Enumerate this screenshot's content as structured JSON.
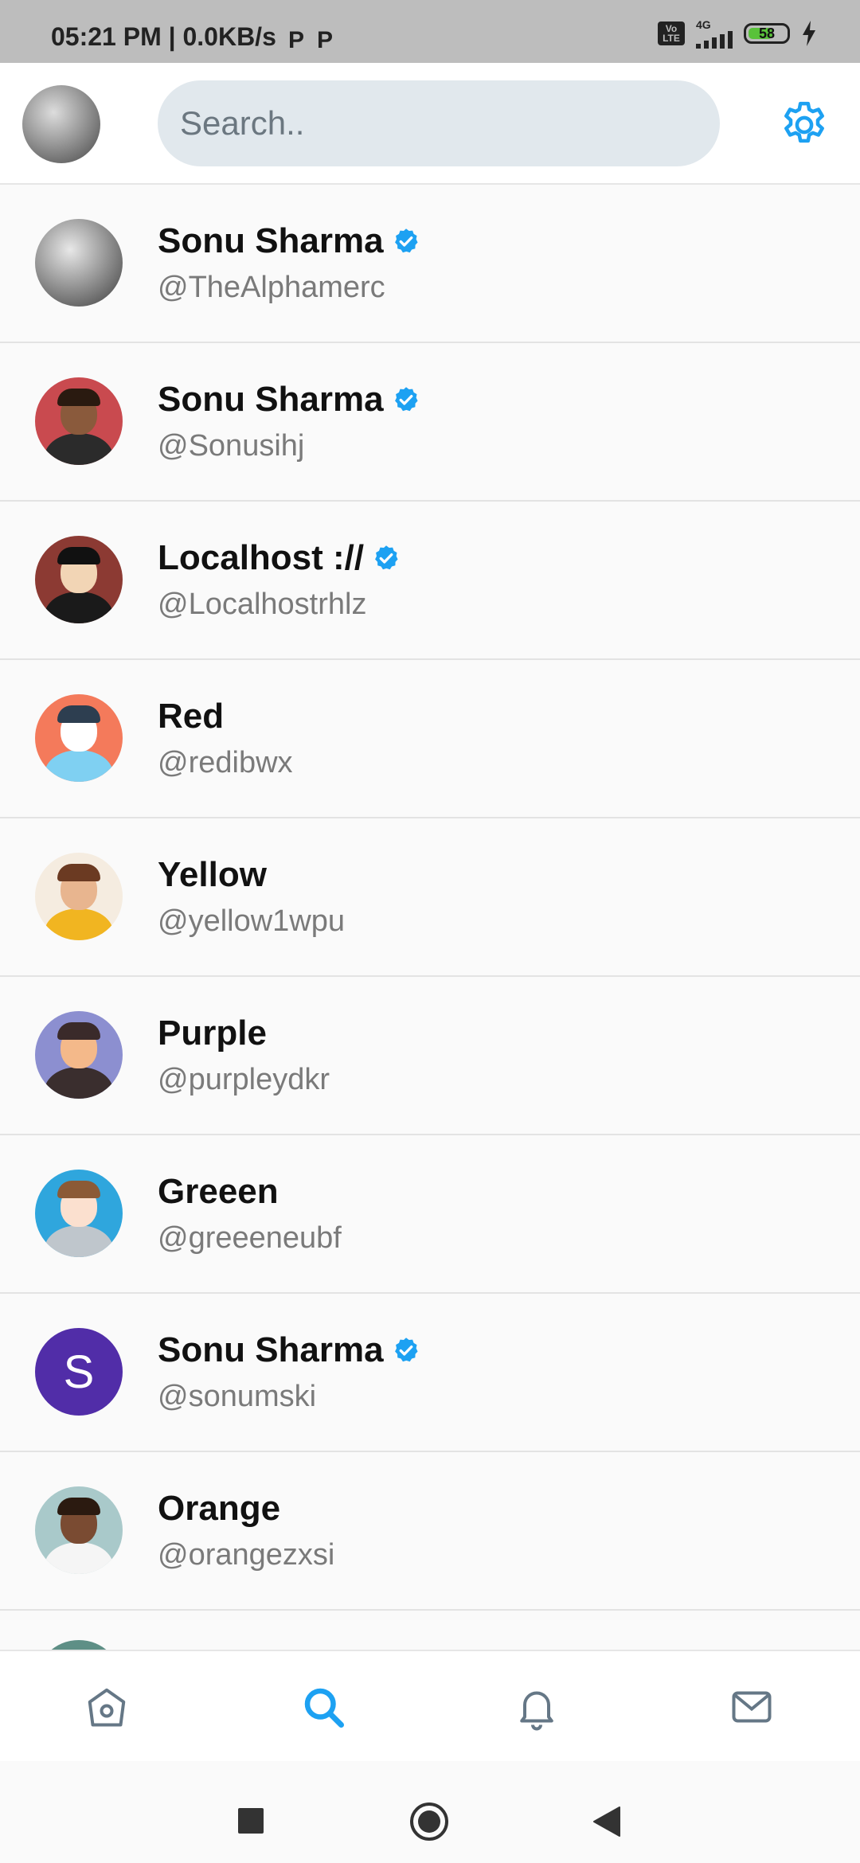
{
  "status_bar": {
    "time": "05:21 PM | 0.0KB/s",
    "battery": "58",
    "network": "4G",
    "volte": "Vo LTE"
  },
  "header": {
    "search_placeholder": "Search..",
    "settings_icon": "gear-icon",
    "accent_color": "#1da1f2"
  },
  "users": [
    {
      "name": "Sonu Sharma",
      "handle": "@TheAlphamerc",
      "verified": true,
      "avatar": "photo-bw"
    },
    {
      "name": "Sonu Sharma",
      "handle": "@Sonusihj",
      "verified": true,
      "avatar": "photo-red"
    },
    {
      "name": "Localhost ://",
      "handle": "@Localhostrhlz",
      "verified": true,
      "avatar": "beard-man"
    },
    {
      "name": "Red",
      "handle": "@redibwx",
      "verified": false,
      "avatar": "red"
    },
    {
      "name": "Yellow",
      "handle": "@yellow1wpu",
      "verified": false,
      "avatar": "yellow"
    },
    {
      "name": "Purple",
      "handle": "@purpleydkr",
      "verified": false,
      "avatar": "purple"
    },
    {
      "name": "Greeen",
      "handle": "@greeeneubf",
      "verified": false,
      "avatar": "green"
    },
    {
      "name": "Sonu Sharma",
      "handle": "@sonumski",
      "verified": true,
      "avatar": "letter",
      "letter": "S"
    },
    {
      "name": "Orange",
      "handle": "@orangezxsi",
      "verified": false,
      "avatar": "orange"
    }
  ],
  "bottom_nav": {
    "items": [
      "home-icon",
      "search-icon",
      "bell-icon",
      "mail-icon"
    ],
    "active": "search-icon"
  }
}
